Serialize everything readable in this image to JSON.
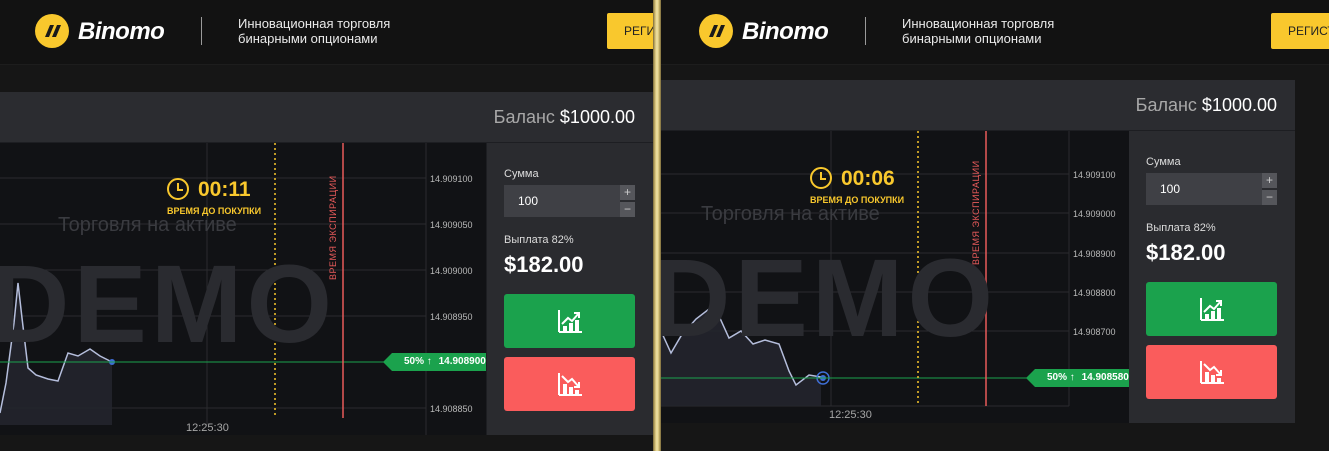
{
  "header": {
    "brand": "Binomo",
    "tagline_line1": "Инновационная торговля",
    "tagline_line2": "бинарными опционами",
    "register_label": "РЕГИСТРАЦИЯ"
  },
  "left": {
    "balance_label": "Баланс",
    "balance_value": "$1000.00",
    "timer": "00:11",
    "timer_label": "ВРЕМЯ ДО ПОКУПКИ",
    "watermark": "DEMO",
    "sub_watermark": "Торговля на активе",
    "expiration_label": "ВРЕМЯ ЭКСПИРАЦИИ",
    "prices": [
      "14.909100",
      "14.909050",
      "14.909000",
      "14.908950",
      "14.908850"
    ],
    "current_price": "14.908900",
    "percent_tag": "50% ↑",
    "time_tick": "12:25:30",
    "sum_label": "Сумма",
    "sum_value": "100",
    "payout_label": "Выплата 82%",
    "payout_value": "$182.00"
  },
  "right": {
    "balance_label": "Баланс",
    "balance_value": "$1000.00",
    "timer": "00:06",
    "timer_label": "ВРЕМЯ ДО ПОКУПКИ",
    "watermark": "DEMO",
    "sub_watermark": "Торговля на активе",
    "expiration_label": "ВРЕМЯ ЭКСПИРАЦИИ",
    "prices": [
      "14.909100",
      "14.909000",
      "14.908900",
      "14.908800",
      "14.908700"
    ],
    "current_price": "14.908580",
    "percent_tag": "50% ↑",
    "time_tick": "12:25:30",
    "sum_label": "Сумма",
    "sum_value": "100",
    "payout_label": "Выплата 82%",
    "payout_value": "$182.00"
  },
  "colors": {
    "brand_yellow": "#f9c82d",
    "up_green": "#1ba24d",
    "down_red": "#fa5c5c",
    "expiration_red": "#e85a5a"
  },
  "icons": [
    "binomo-logo-icon",
    "clock-icon",
    "chart-up-icon",
    "chart-down-icon",
    "plus-icon",
    "minus-icon"
  ]
}
